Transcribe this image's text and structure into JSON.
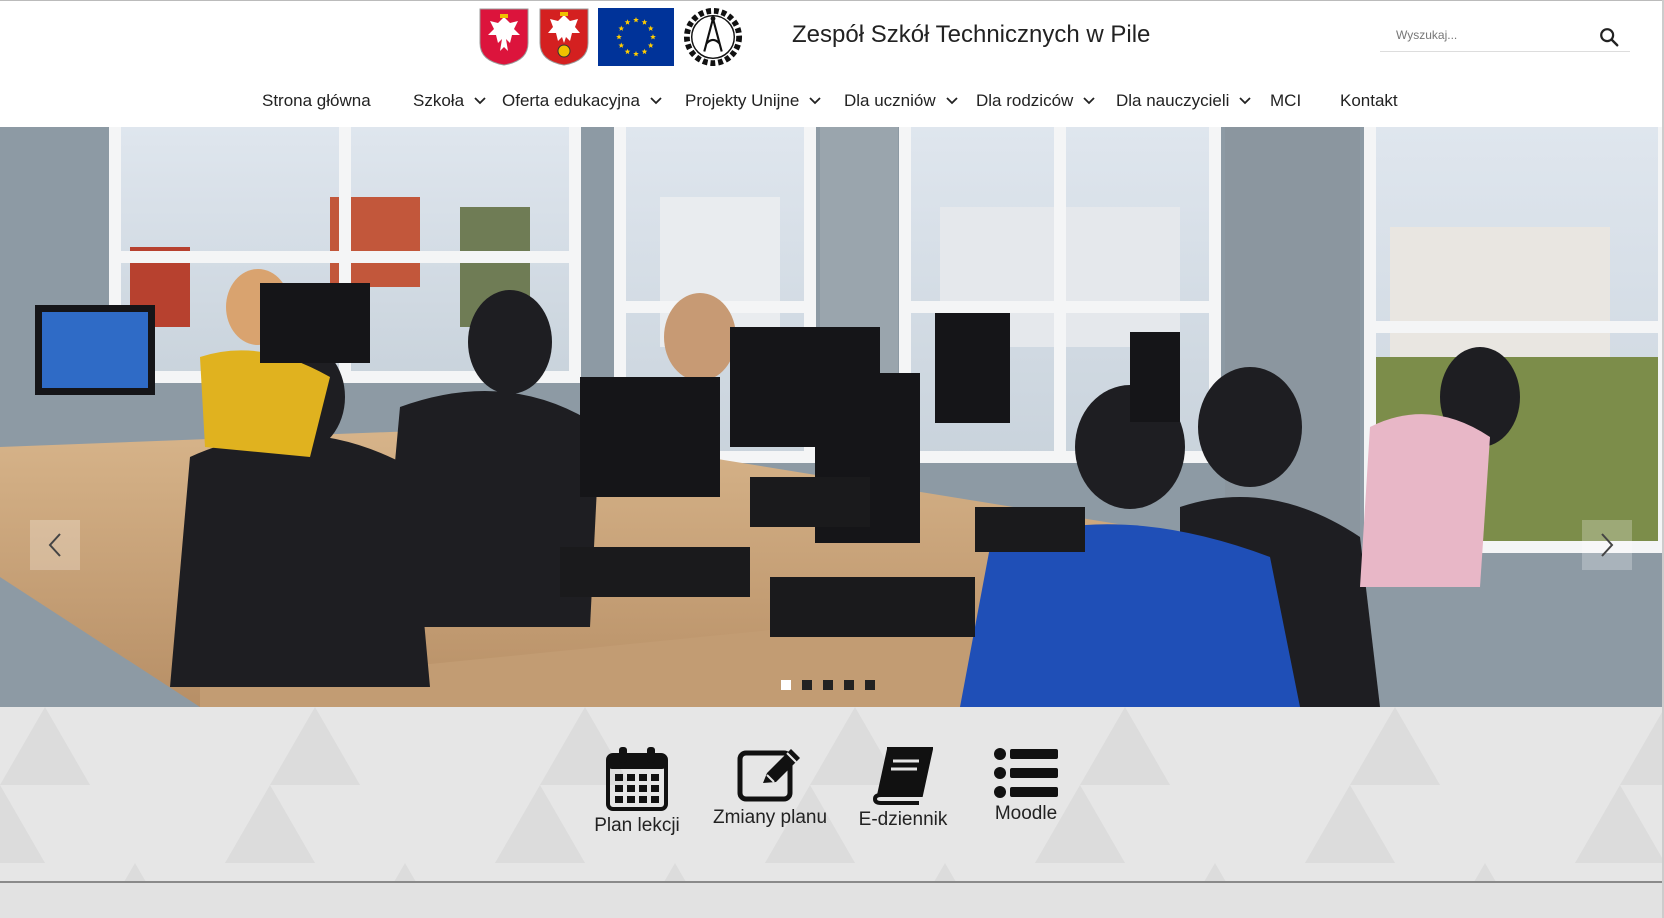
{
  "header": {
    "site_title": "Zespół Szkół Technicznych w Pile",
    "logos": [
      "poland-coat-of-arms",
      "pila-county-coat-of-arms",
      "eu-flag",
      "school-emblem"
    ],
    "school_emblem_text": "ZESPÓŁ SZKÓŁ TECHNICZNYCH PIŁA",
    "search": {
      "placeholder": "Wyszukaj..."
    }
  },
  "nav": {
    "items": [
      {
        "label": "Strona główna",
        "dropdown": false
      },
      {
        "label": "Szkoła",
        "dropdown": true
      },
      {
        "label": "Oferta edukacyjna",
        "dropdown": true
      },
      {
        "label": "Projekty Unijne",
        "dropdown": true
      },
      {
        "label": "Dla uczniów",
        "dropdown": true
      },
      {
        "label": "Dla rodziców",
        "dropdown": true
      },
      {
        "label": "Dla nauczycieli",
        "dropdown": true
      },
      {
        "label": "MCI",
        "dropdown": false
      },
      {
        "label": "Kontakt",
        "dropdown": false
      }
    ]
  },
  "slider": {
    "slide_count": 5,
    "active_slide": 1,
    "prev_icon": "chevron-left-icon",
    "next_icon": "chevron-right-icon"
  },
  "quick_links": [
    {
      "label": "Plan lekcji",
      "icon": "calendar-icon"
    },
    {
      "label": "Zmiany planu",
      "icon": "edit-icon"
    },
    {
      "label": "E-dziennik",
      "icon": "book-icon"
    },
    {
      "label": "Moodle",
      "icon": "list-icon"
    }
  ],
  "colors": {
    "header_bg": "#ffffff",
    "quick_links_bg": "#e6e6e6",
    "text": "#222222",
    "eu_blue": "#003399",
    "eu_yellow": "#ffcc00",
    "poland_red": "#dc143c"
  }
}
